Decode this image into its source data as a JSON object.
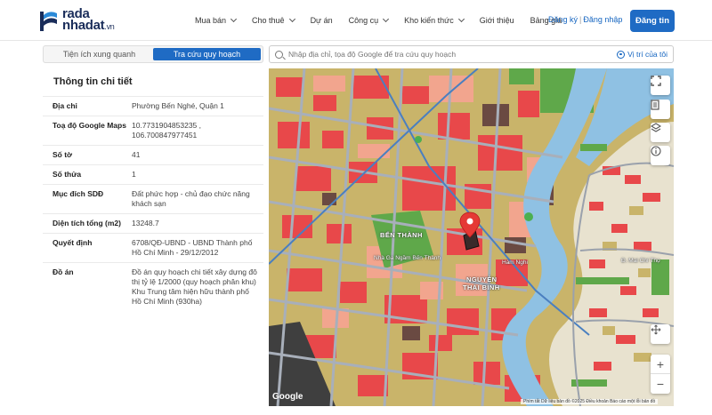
{
  "header": {
    "logo": {
      "line1": "rada",
      "line2": "nhadat",
      "suffix": ".vn"
    },
    "nav": [
      {
        "label": "Mua bán",
        "dropdown": true
      },
      {
        "label": "Cho thuê",
        "dropdown": true
      },
      {
        "label": "Dự án",
        "dropdown": false
      },
      {
        "label": "Công cụ",
        "dropdown": true
      },
      {
        "label": "Kho kiến thức",
        "dropdown": true
      },
      {
        "label": "Giới thiệu",
        "dropdown": false
      },
      {
        "label": "Bảng giá",
        "dropdown": false
      }
    ],
    "register": "Đăng ký",
    "separator": "|",
    "login": "Đăng nhập",
    "post_button": "Đăng tin"
  },
  "tabs": [
    {
      "label": "Tiện ích xung quanh",
      "active": false
    },
    {
      "label": "Tra cứu quy hoạch",
      "active": true
    }
  ],
  "search": {
    "placeholder": "Nhập địa chỉ, tọa độ Google để tra cứu quy hoạch",
    "locate_label": "Vị trí của tôi"
  },
  "details": {
    "title": "Thông tin chi tiết",
    "rows": [
      {
        "label": "Địa chỉ",
        "value": "Phường Bến Nghé, Quận 1"
      },
      {
        "label": "Toạ độ Google Maps",
        "value": "10.7731904853235 , 106.700847977451"
      },
      {
        "label": "Số tờ",
        "value": "41"
      },
      {
        "label": "Số thửa",
        "value": "1"
      },
      {
        "label": "Mục đích SDĐ",
        "value": "Đất phức hợp - chủ đạo chức năng khách sạn"
      },
      {
        "label": "Diện tích tổng (m2)",
        "value": "13248.7"
      },
      {
        "label": "Quyết định",
        "value": "6708/QĐ-UBND - UBND Thành phố Hồ Chí Minh - 29/12/2012"
      },
      {
        "label": "Đồ án",
        "value": "Đồ án quy hoạch chi tiết xây dựng đô thị tỷ lệ 1/2000 (quy hoạch phân khu) Khu Trung tâm hiện hữu thành phố Hồ Chí Minh (930ha)"
      }
    ]
  },
  "map": {
    "labels": {
      "ben_thanh": "BẾN THÀNH",
      "nguyen_thai_binh_1": "NGUYỄN",
      "nguyen_thai_binh_2": "THÁI BÌNH",
      "ham_nghi": "Hàm Nghi",
      "ben_xe": "Nhà Ga Ngầm Bến Thành",
      "mai_chi_tho": "Đ. Mai Chí Thọ",
      "google": "Google",
      "attribution": "Phím tắt   Dữ liệu bản đồ ©2025   Điều khoản   Báo cáo một lỗi bản đồ"
    },
    "zoom_in": "+",
    "zoom_out": "−"
  },
  "colors": {
    "accent": "#1f6bc4",
    "link": "#1565c0",
    "brand_dark": "#1a2d5a",
    "zone_commercial": "#e8484a",
    "zone_residential": "#b8a55b",
    "zone_green": "#5fa84a",
    "zone_mixed": "#f0a38d",
    "water": "#8fc1e3",
    "road": "#9fa6b2"
  }
}
